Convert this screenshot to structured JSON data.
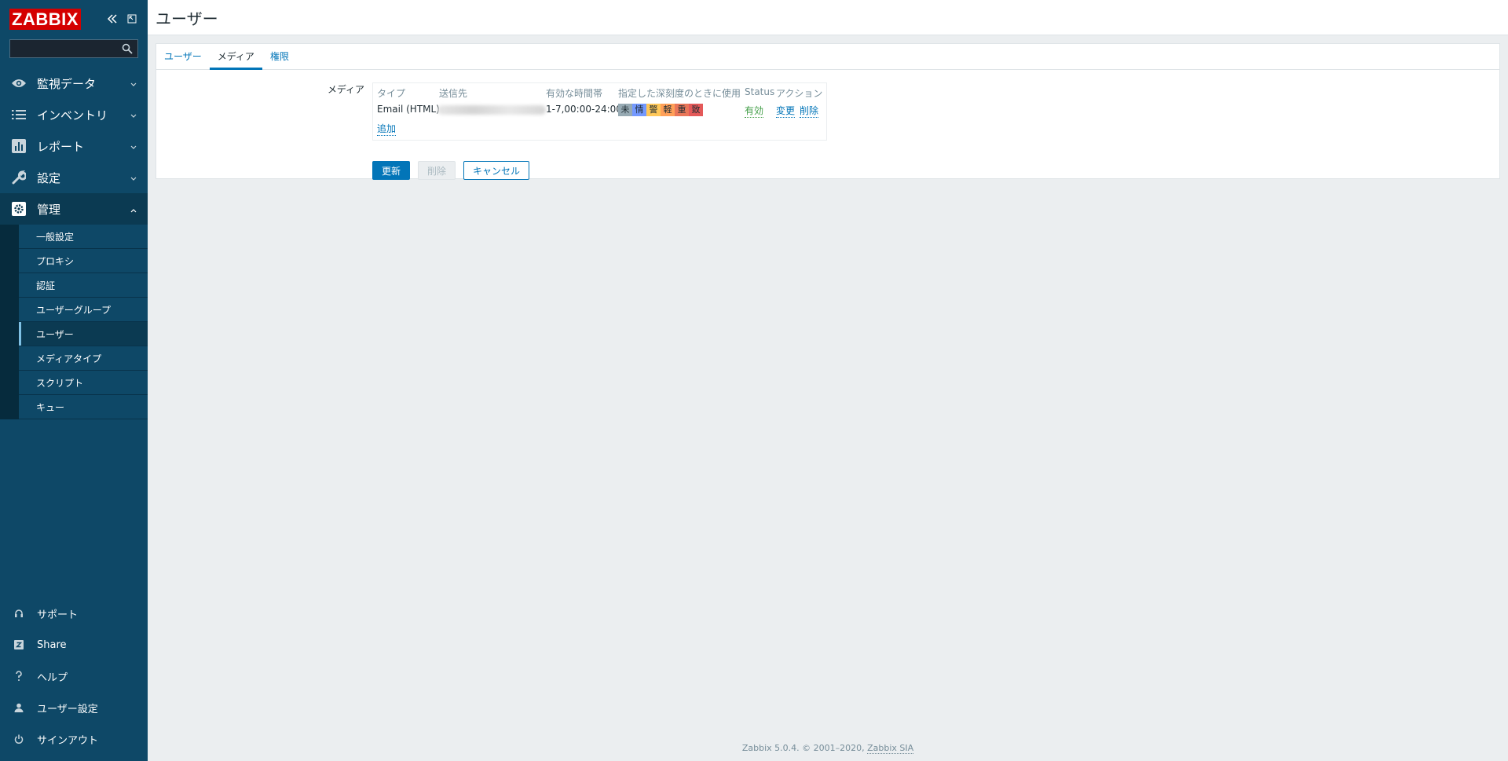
{
  "sidebar": {
    "logo": "ZABBIX",
    "search_placeholder": "",
    "menu": [
      {
        "label": "監視データ",
        "icon": "eye-icon"
      },
      {
        "label": "インベントリ",
        "icon": "list-icon"
      },
      {
        "label": "レポート",
        "icon": "chart-icon"
      },
      {
        "label": "設定",
        "icon": "wrench-icon"
      },
      {
        "label": "管理",
        "icon": "gear-icon"
      }
    ],
    "admin_submenu": [
      "一般設定",
      "プロキシ",
      "認証",
      "ユーザーグループ",
      "ユーザー",
      "メディアタイプ",
      "スクリプト",
      "キュー"
    ],
    "bottom": [
      {
        "label": "サポート",
        "icon": "headset-icon"
      },
      {
        "label": "Share",
        "icon": "share-icon"
      },
      {
        "label": "ヘルプ",
        "icon": "help-icon"
      },
      {
        "label": "ユーザー設定",
        "icon": "user-icon"
      },
      {
        "label": "サインアウト",
        "icon": "power-icon"
      }
    ]
  },
  "header": {
    "title": "ユーザー"
  },
  "tabs": [
    "ユーザー",
    "メディア",
    "権限"
  ],
  "form": {
    "media_label": "メディア",
    "columns": [
      "タイプ",
      "送信先",
      "有効な時間帯",
      "指定した深刻度のときに使用",
      "Status",
      "アクション"
    ],
    "row": {
      "type": "Email (HTML)",
      "period": "1-7,00:00-24:00",
      "severities": [
        {
          "label": "未",
          "color": "#97aab3"
        },
        {
          "label": "情",
          "color": "#7499ff"
        },
        {
          "label": "警",
          "color": "#ffc859"
        },
        {
          "label": "軽",
          "color": "#ffa059"
        },
        {
          "label": "重",
          "color": "#e97659"
        },
        {
          "label": "致",
          "color": "#e45959"
        }
      ],
      "status": "有効",
      "edit": "変更",
      "remove": "削除"
    },
    "add": "追加",
    "buttons": {
      "update": "更新",
      "delete": "削除",
      "cancel": "キャンセル"
    }
  },
  "footer": {
    "text": "Zabbix 5.0.4. © 2001–2020, ",
    "link": "Zabbix SIA"
  }
}
